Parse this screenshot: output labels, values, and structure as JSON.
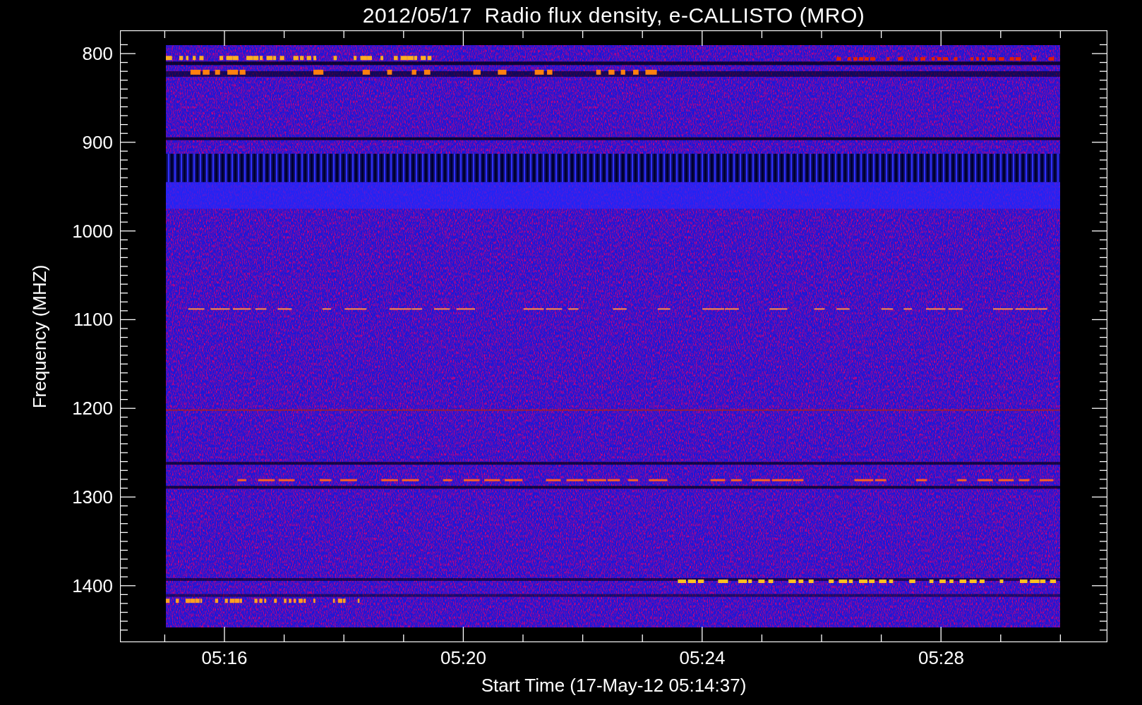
{
  "title": "2012/05/17  Radio flux density, e-CALLISTO (MRO)",
  "y_axis": {
    "label": "Frequency (MHZ)",
    "ticks": [
      "800",
      "900",
      "1000",
      "1100",
      "1200",
      "1300",
      "1400"
    ]
  },
  "x_axis": {
    "label": "Start Time (17-May-12 05:14:37)",
    "ticks": [
      "05:16",
      "05:20",
      "05:24",
      "05:28"
    ]
  }
}
